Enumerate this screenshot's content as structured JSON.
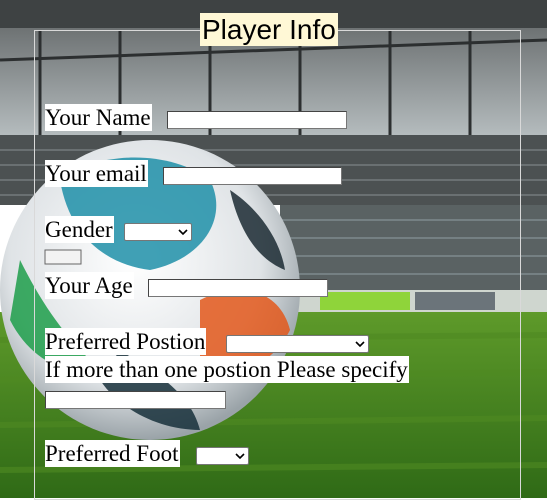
{
  "form": {
    "title": "Player Info",
    "name_label": "Your Name",
    "email_label": "Your email",
    "gender_label": "Gender",
    "age_label": "Your Age",
    "position_label": "Preferred Postion",
    "multi_position_label": "If more than one postion Please specify",
    "foot_label": "Preferred Foot"
  },
  "fields": {
    "name_value": "",
    "email_value": "",
    "gender_selected": "",
    "age_value": "",
    "position_selected": "",
    "multi_position_value": "",
    "foot_selected": ""
  },
  "icons": {
    "select_arrow": "chevron-down-icon"
  },
  "colors": {
    "title_bg": "#fff8d6",
    "label_bg": "#ffffff",
    "frame_border": "#d9d9d9"
  }
}
